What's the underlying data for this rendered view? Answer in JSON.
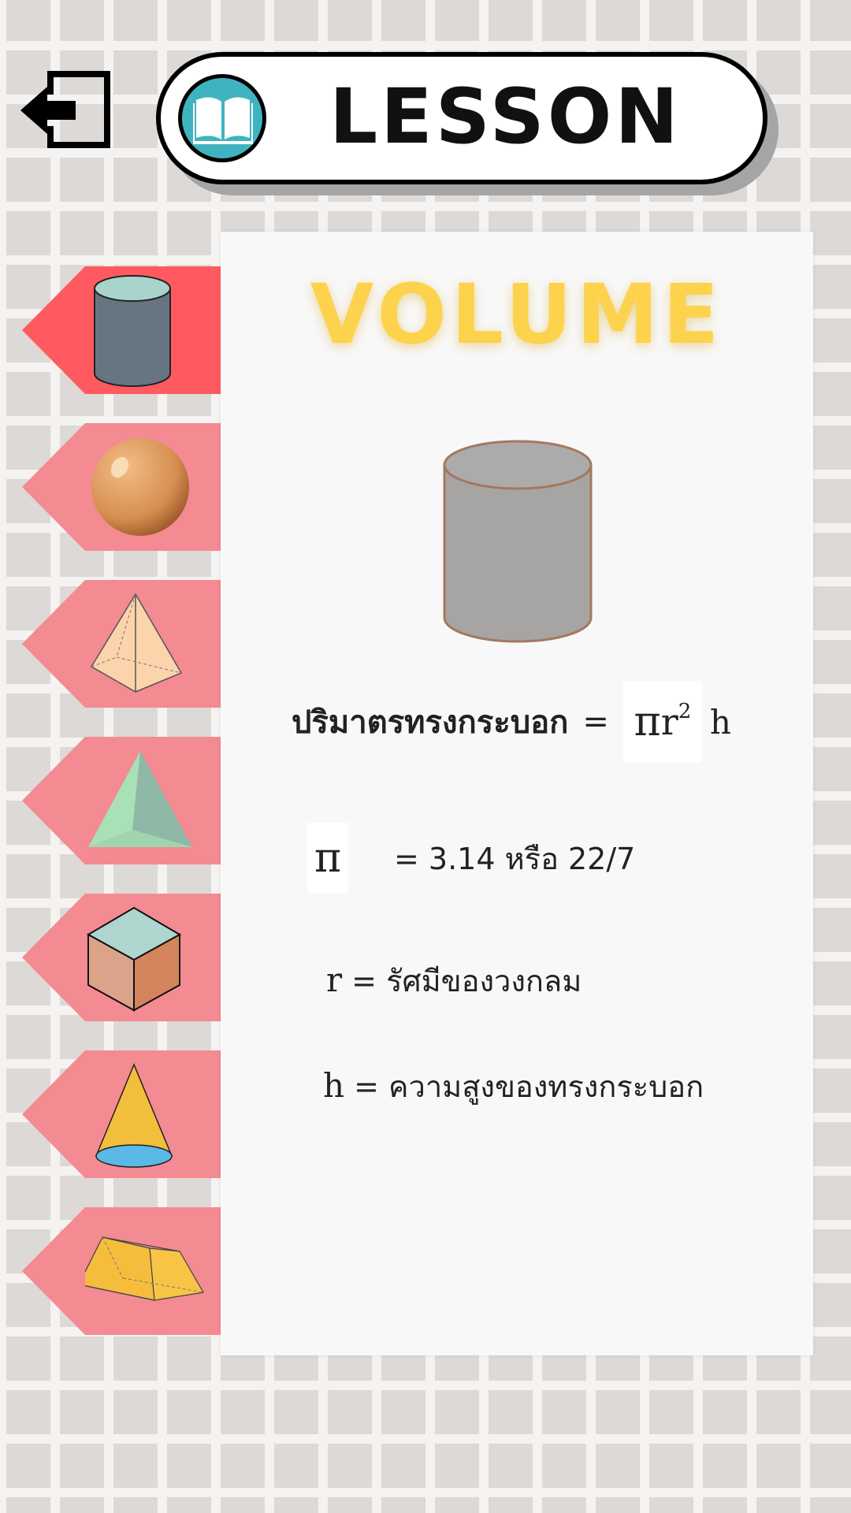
{
  "header": {
    "title": "LESSON",
    "icon": "open-book-icon",
    "accent_color": "#3fb4c0"
  },
  "back_button": {
    "icon": "exit-arrow-icon"
  },
  "shape_tabs": [
    {
      "shape": "cylinder",
      "icon": "cylinder-icon",
      "active": true
    },
    {
      "shape": "sphere",
      "icon": "sphere-icon",
      "active": false
    },
    {
      "shape": "square-pyramid",
      "icon": "square-pyramid-icon",
      "active": false
    },
    {
      "shape": "triangular-pyramid",
      "icon": "triangular-pyramid-icon",
      "active": false
    },
    {
      "shape": "cube",
      "icon": "cube-icon",
      "active": false
    },
    {
      "shape": "cone",
      "icon": "cone-icon",
      "active": false
    },
    {
      "shape": "triangular-prism",
      "icon": "triangular-prism-icon",
      "active": false
    }
  ],
  "tab_colors": {
    "active": "#ff5a5f",
    "inactive": "#f48a92"
  },
  "panel": {
    "title": "VOLUME",
    "title_color": "#fdd24d",
    "illustration": "cylinder-illustration",
    "formula": {
      "label": "ปริมาตรทรงกระบอก",
      "equals": "=",
      "pi": "π",
      "r": "r",
      "exponent": "2",
      "h": "h"
    },
    "pi_def": {
      "symbol": "π",
      "value": "= 3.14  หรือ  22/7"
    },
    "r_def": {
      "symbol": "r",
      "text": " =  รัศมีของวงกลม"
    },
    "h_def": {
      "symbol": "h",
      "text": "  =  ความสูงของทรงกระบอก"
    }
  }
}
